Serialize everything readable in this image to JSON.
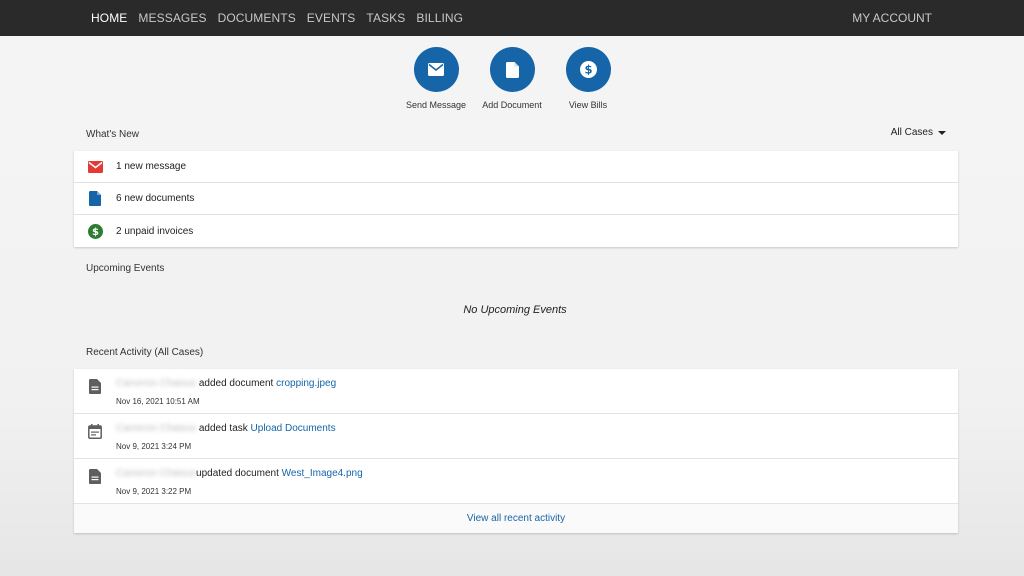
{
  "nav": {
    "items": [
      {
        "label": "HOME",
        "active": true
      },
      {
        "label": "MESSAGES"
      },
      {
        "label": "DOCUMENTS"
      },
      {
        "label": "EVENTS"
      },
      {
        "label": "TASKS"
      },
      {
        "label": "BILLING"
      }
    ],
    "account": "MY ACCOUNT"
  },
  "actions": [
    {
      "label": "Send Message",
      "icon": "envelope-icon"
    },
    {
      "label": "Add Document",
      "icon": "document-icon"
    },
    {
      "label": "View Bills",
      "icon": "dollar-icon"
    }
  ],
  "whats_new": {
    "title": "What's New",
    "filter": "All Cases",
    "items": [
      {
        "text": "1 new message",
        "icon": "envelope-icon",
        "color": "#e53935"
      },
      {
        "text": "6 new documents",
        "icon": "document-icon",
        "color": "#1565a8"
      },
      {
        "text": "2 unpaid invoices",
        "icon": "dollar-icon",
        "color": "#2e7d32"
      }
    ]
  },
  "upcoming": {
    "title": "Upcoming Events",
    "empty": "No Upcoming Events"
  },
  "recent": {
    "title": "Recent Activity (All Cases)",
    "items": [
      {
        "who": "Cameron Chaisus",
        "action": " added document ",
        "link": "cropping.jpeg",
        "time": "Nov 16, 2021 10:51 AM",
        "icon": "document-icon"
      },
      {
        "who": "Cameron Chaisus",
        "action": " added task ",
        "link": "Upload Documents",
        "time": "Nov 9, 2021 3:24 PM",
        "icon": "calendar-icon"
      },
      {
        "who": "Cameron Chaisus",
        "action": "updated document ",
        "link": "West_Image4.png",
        "time": "Nov 9, 2021 3:22 PM",
        "icon": "document-icon"
      }
    ],
    "view_all": "View all recent activity"
  }
}
